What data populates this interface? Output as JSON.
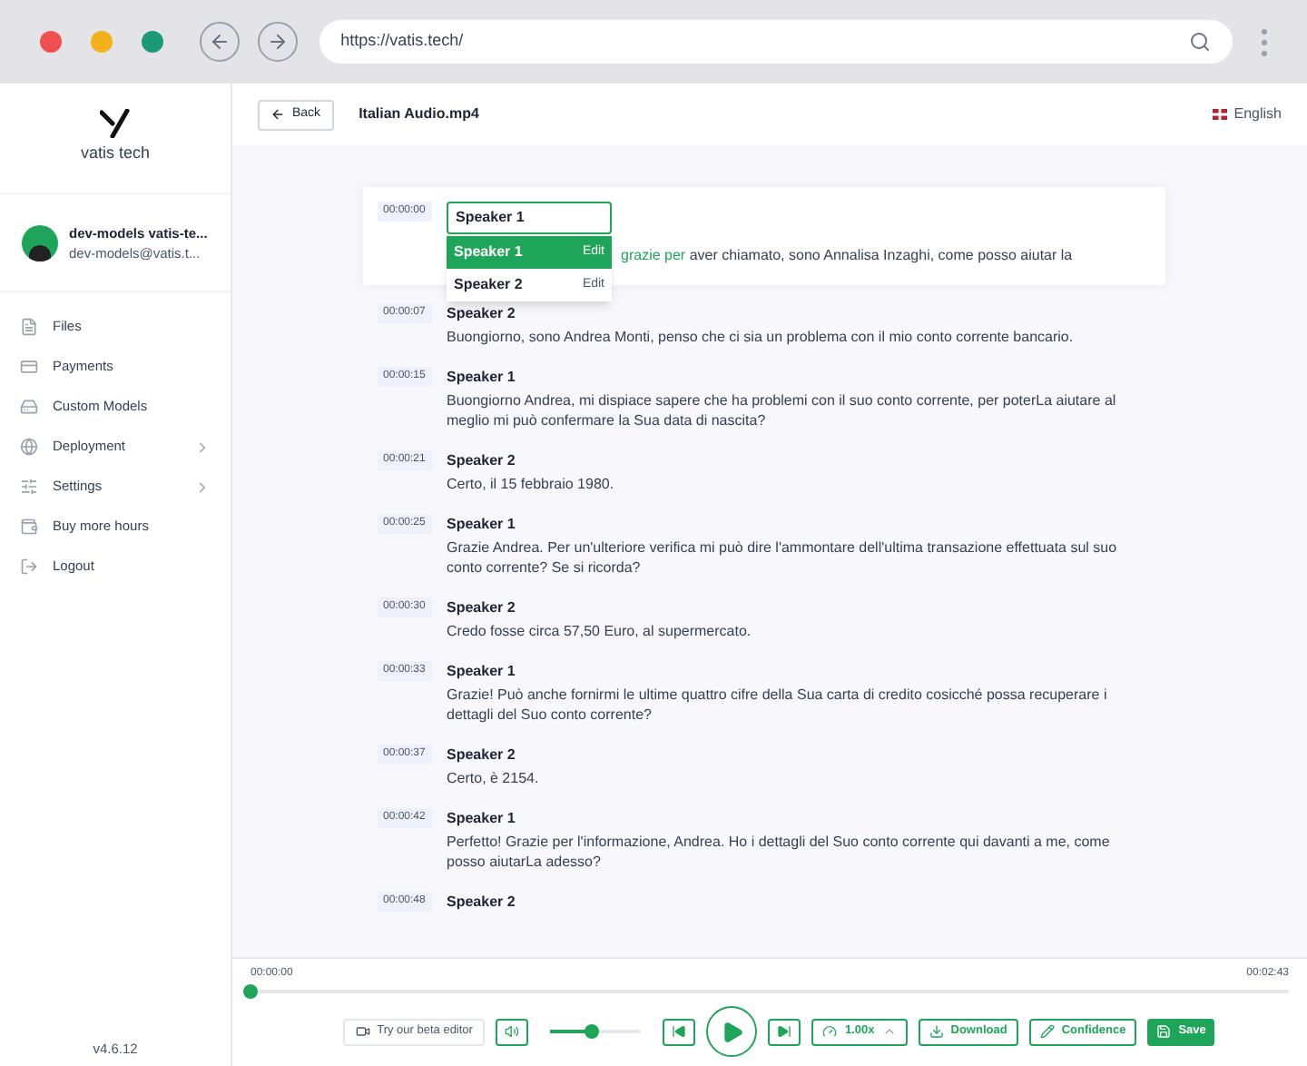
{
  "browser": {
    "url": "https://vatis.tech/"
  },
  "sidebar": {
    "logo_text": "vatis tech",
    "user": {
      "name": "dev-models vatis-te...",
      "email": "dev-models@vatis.t..."
    },
    "items": [
      {
        "label": "Files",
        "kind": "file",
        "expandable": false
      },
      {
        "label": "Payments",
        "kind": "payment",
        "expandable": false
      },
      {
        "label": "Custom Models",
        "kind": "model",
        "expandable": false
      },
      {
        "label": "Deployment",
        "kind": "deploy",
        "expandable": true
      },
      {
        "label": "Settings",
        "kind": "settings",
        "expandable": true
      },
      {
        "label": "Buy more hours",
        "kind": "card",
        "expandable": false
      },
      {
        "label": "Logout",
        "kind": "logout",
        "expandable": false
      }
    ],
    "version": "v4.6.12"
  },
  "header": {
    "back": "Back",
    "title": "Italian Audio.mp4",
    "language": "English"
  },
  "editing": {
    "time": "00:00:00",
    "speaker_value": "Speaker 1",
    "highlight": "grazie per",
    "text": "aver chiamato, sono Annalisa Inzaghi, come posso aiutar la",
    "options": [
      {
        "label": "Speaker 1",
        "action": "Edit",
        "selected": true
      },
      {
        "label": "Speaker 2",
        "action": "Edit",
        "selected": false
      }
    ]
  },
  "segments": [
    {
      "time": "00:00:07",
      "speaker": "Speaker 2",
      "text": "Buongiorno, sono Andrea Monti, penso che ci sia un problema con il mio conto corrente bancario."
    },
    {
      "time": "00:00:15",
      "speaker": "Speaker 1",
      "text": "Buongiorno Andrea, mi dispiace sapere che ha problemi con il suo conto corrente, per poterLa aiutare al meglio mi può confermare la Sua data di nascita?"
    },
    {
      "time": "00:00:21",
      "speaker": "Speaker 2",
      "text": "Certo, il 15 febbraio 1980."
    },
    {
      "time": "00:00:25",
      "speaker": "Speaker 1",
      "text": "Grazie Andrea. Per un'ulteriore verifica mi può dire l'ammontare dell'ultima transazione effettuata sul suo conto corrente? Se si ricorda?"
    },
    {
      "time": "00:00:30",
      "speaker": "Speaker 2",
      "text": "Credo fosse circa 57,50 Euro, al supermercato."
    },
    {
      "time": "00:00:33",
      "speaker": "Speaker 1",
      "text": "Grazie! Può anche fornirmi le ultime quattro cifre della Sua carta di credito cosicché possa recuperare i dettagli del Suo conto corrente?"
    },
    {
      "time": "00:00:37",
      "speaker": "Speaker 2",
      "text": "Certo, è 2154."
    },
    {
      "time": "00:00:42",
      "speaker": "Speaker 1",
      "text": "Perfetto! Grazie per l'informazione, Andrea. Ho i dettagli del Suo conto corrente qui davanti a me, come posso aiutarLa adesso?"
    },
    {
      "time": "00:00:48",
      "speaker": "Speaker 2"
    }
  ],
  "player": {
    "current": "00:00:00",
    "duration": "00:02:43",
    "progress": {
      "level": 0
    },
    "volume": {
      "level": 0.45
    },
    "beta": "Try our beta editor",
    "speed": "1.00x",
    "download": "Download",
    "confidence": "Confidence",
    "save": "Save"
  }
}
